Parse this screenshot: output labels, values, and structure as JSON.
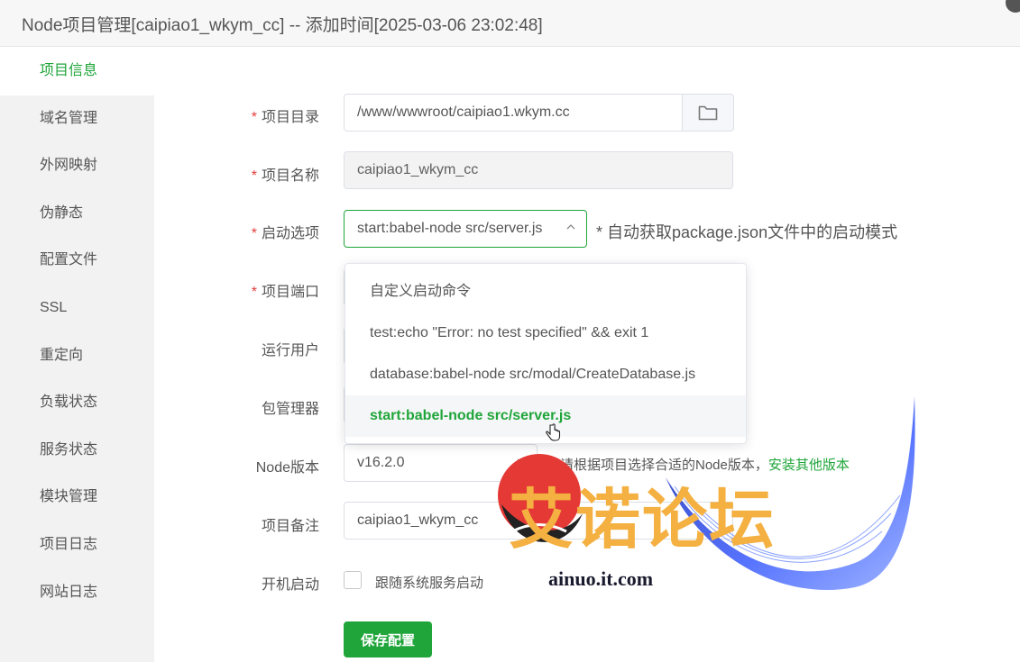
{
  "window": {
    "title": "Node项目管理[caipiao1_wkym_cc] -- 添加时间[2025-03-06 23:02:48]"
  },
  "sidebar": {
    "items": [
      {
        "label": "项目信息",
        "active": true
      },
      {
        "label": "域名管理"
      },
      {
        "label": "外网映射"
      },
      {
        "label": "伪静态"
      },
      {
        "label": "配置文件"
      },
      {
        "label": "SSL"
      },
      {
        "label": "重定向"
      },
      {
        "label": "负载状态"
      },
      {
        "label": "服务状态"
      },
      {
        "label": "模块管理"
      },
      {
        "label": "项目日志"
      },
      {
        "label": "网站日志"
      }
    ]
  },
  "form": {
    "required_mark": "*",
    "project_dir": {
      "label": "项目目录",
      "value": "/www/wwwroot/caipiao1.wkym.cc"
    },
    "project_name": {
      "label": "项目名称",
      "value": "caipiao1_wkym_cc"
    },
    "start_option": {
      "label": "启动选项",
      "value": "start:babel-node src/server.js",
      "hint": "* 自动获取package.json文件中的启动模式"
    },
    "project_port": {
      "label": "项目端口"
    },
    "run_user": {
      "label": "运行用户"
    },
    "package_manager": {
      "label": "包管理器"
    },
    "node_version": {
      "label": "Node版本",
      "value": "v16.2.0",
      "hint": "请根据项目选择合适的Node版本，",
      "link": "安装其他版本"
    },
    "remark": {
      "label": "项目备注",
      "value": "caipiao1_wkym_cc"
    },
    "autostart": {
      "label": "开机启动",
      "checkbox_label": "跟随系统服务启动",
      "checked": false
    },
    "save_label": "保存配置"
  },
  "dropdown": {
    "options": [
      {
        "label": "自定义启动命令"
      },
      {
        "label": "test:echo \"Error: no test specified\" && exit 1"
      },
      {
        "label": "database:babel-node src/modal/CreateDatabase.js"
      },
      {
        "label": "start:babel-node src/server.js",
        "selected": true
      }
    ]
  },
  "watermark": {
    "text": "艾诺论坛",
    "url": "ainuo.it.com"
  },
  "colors": {
    "accent": "#20a53a",
    "required": "#e23c3c",
    "watermark_text": "#f4b040",
    "watermark_red": "#e53935"
  }
}
